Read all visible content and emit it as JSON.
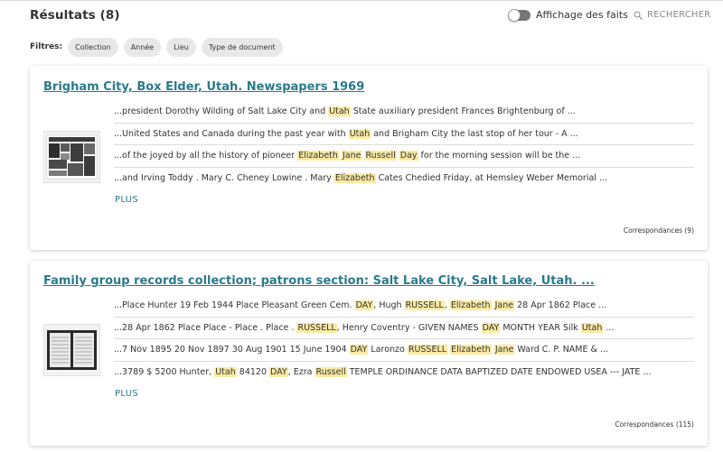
{
  "header": {
    "results_title": "Résultats (8)",
    "facts_toggle_label": "Affichage des faits",
    "search_label": "RECHERCHER"
  },
  "filters": {
    "label": "Filtres:",
    "chips": [
      "Collection",
      "Année",
      "Lieu",
      "Type de document"
    ]
  },
  "results": [
    {
      "title": "Brigham City, Box Elder, Utah. Newspapers 1969",
      "thumbnail": "newspaper-page-thumbnail",
      "snippets": [
        [
          {
            "t": "...president Dorothy Wilding of Salt Lake City and "
          },
          {
            "t": "Utah",
            "hl": true
          },
          {
            "t": " State auxiliary president Frances Brightenburg of ..."
          }
        ],
        [
          {
            "t": "...United States and Canada during the past year with "
          },
          {
            "t": "Utah",
            "hl": true
          },
          {
            "t": " and Brigham City the last stop of her tour - A ..."
          }
        ],
        [
          {
            "t": "...of the joyed by all the history of pioneer "
          },
          {
            "t": "Elizabeth",
            "hl": true
          },
          {
            "t": " "
          },
          {
            "t": "Jane",
            "hl": true
          },
          {
            "t": " "
          },
          {
            "t": "Russell",
            "hl": true
          },
          {
            "t": " "
          },
          {
            "t": "Day",
            "hl": true
          },
          {
            "t": " for the morning session will be the ..."
          }
        ],
        [
          {
            "t": "...and Irving Toddy . Mary C. Cheney Lowine . Mary "
          },
          {
            "t": "Elizabeth",
            "hl": true
          },
          {
            "t": " Cates Chedied Friday, at Hemsley Weber Memorial ..."
          }
        ]
      ],
      "more_label": "PLUS",
      "matches_label": "Correspondances (9)"
    },
    {
      "title": "Family group records collection; patrons section: Salt Lake City, Salt Lake, Utah. ...",
      "thumbnail": "record-sheet-thumbnail",
      "snippets": [
        [
          {
            "t": "...Place Hunter 19 Feb 1944 Place Pleasant Green Cem. "
          },
          {
            "t": "DAY",
            "hl": true
          },
          {
            "t": ", Hugh "
          },
          {
            "t": "RUSSELL",
            "hl": true
          },
          {
            "t": ", "
          },
          {
            "t": "Elizabeth",
            "hl": true
          },
          {
            "t": " "
          },
          {
            "t": "Jane",
            "hl": true
          },
          {
            "t": " 28 Apr 1862 Place ..."
          }
        ],
        [
          {
            "t": "...28 Apr 1862 Place Place - Place . Place . "
          },
          {
            "t": "RUSSELL",
            "hl": true
          },
          {
            "t": ", Henry Coventry - GIVEN NAMES "
          },
          {
            "t": "DAY",
            "hl": true
          },
          {
            "t": " MONTH YEAR Silk "
          },
          {
            "t": "Utah",
            "hl": true
          },
          {
            "t": " ..."
          }
        ],
        [
          {
            "t": "...7 Nov 1895 20 Nov 1897 30 Aug 1901 15 June 1904 "
          },
          {
            "t": "DAY",
            "hl": true
          },
          {
            "t": " Laronzo "
          },
          {
            "t": "RUSSELL",
            "hl": true
          },
          {
            "t": " "
          },
          {
            "t": "Elizabeth",
            "hl": true
          },
          {
            "t": " "
          },
          {
            "t": "Jane",
            "hl": true
          },
          {
            "t": " Ward C. P. NAME & ..."
          }
        ],
        [
          {
            "t": "...3789 $ 5200 Hunter, "
          },
          {
            "t": "Utah",
            "hl": true
          },
          {
            "t": " 84120 "
          },
          {
            "t": "DAY",
            "hl": true
          },
          {
            "t": ", Ezra "
          },
          {
            "t": "Russell",
            "hl": true
          },
          {
            "t": " TEMPLE ORDINANCE DATA BAPTIZED DATE ENDOWED USEA --- JATE ..."
          }
        ]
      ],
      "more_label": "PLUS",
      "matches_label": "Correspondances (115)"
    }
  ],
  "colors": {
    "link": "#2b7a8a",
    "highlight": "#fbeaa3",
    "chip_bg": "#e8e8e8",
    "toggle_track": "#767676"
  }
}
